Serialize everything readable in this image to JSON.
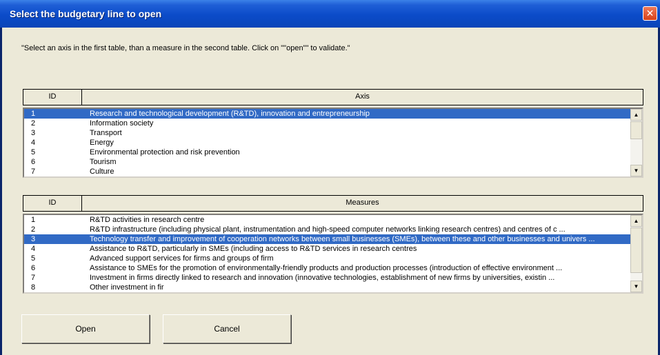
{
  "window": {
    "title": "Select the budgetary line to open",
    "close_symbol": "✕"
  },
  "instruction": "\"Select an axis in the first table, than a measure in the second table. Click on \"\"open\"\" to validate.\"",
  "axis_table": {
    "header_id": "ID",
    "header_name": "Axis",
    "selected_index": 0,
    "rows": [
      {
        "id": "1",
        "text": "Research and technological development (R&TD), innovation and entrepreneurship"
      },
      {
        "id": "2",
        "text": "Information society"
      },
      {
        "id": "3",
        "text": "Transport"
      },
      {
        "id": "4",
        "text": "Energy"
      },
      {
        "id": "5",
        "text": "Environmental protection and risk prevention"
      },
      {
        "id": "6",
        "text": "Tourism"
      },
      {
        "id": "7",
        "text": "Culture"
      }
    ]
  },
  "measures_table": {
    "header_id": "ID",
    "header_name": "Measures",
    "selected_index": 2,
    "rows": [
      {
        "id": "1",
        "text": "R&TD activities in research centre"
      },
      {
        "id": "2",
        "text": "R&TD infrastructure  (including physical plant, instrumentation and high-speed computer networks linking research centres)  and centres of c ..."
      },
      {
        "id": "3",
        "text": "Technology transfer and improvement of cooperation networks between small businesses (SMEs), between these and  other businesses and univers ..."
      },
      {
        "id": "4",
        "text": "Assistance to R&TD, particularly in SMEs (including access to R&TD services in research centres"
      },
      {
        "id": "5",
        "text": "Advanced support services for firms and groups of firm"
      },
      {
        "id": "6",
        "text": "Assistance to SMEs for the promotion  of environmentally-friendly products and production processes  (introduction of effective  environment ..."
      },
      {
        "id": "7",
        "text": "Investment in firms directly linked to research and innovation (innovative technologies, establishment of new firms by universities, existin ..."
      },
      {
        "id": "8",
        "text": "Other investment in fir"
      }
    ]
  },
  "buttons": {
    "open_label": "Open",
    "cancel_label": "Cancel"
  },
  "scroll": {
    "up_symbol": "▲",
    "down_symbol": "▼"
  }
}
